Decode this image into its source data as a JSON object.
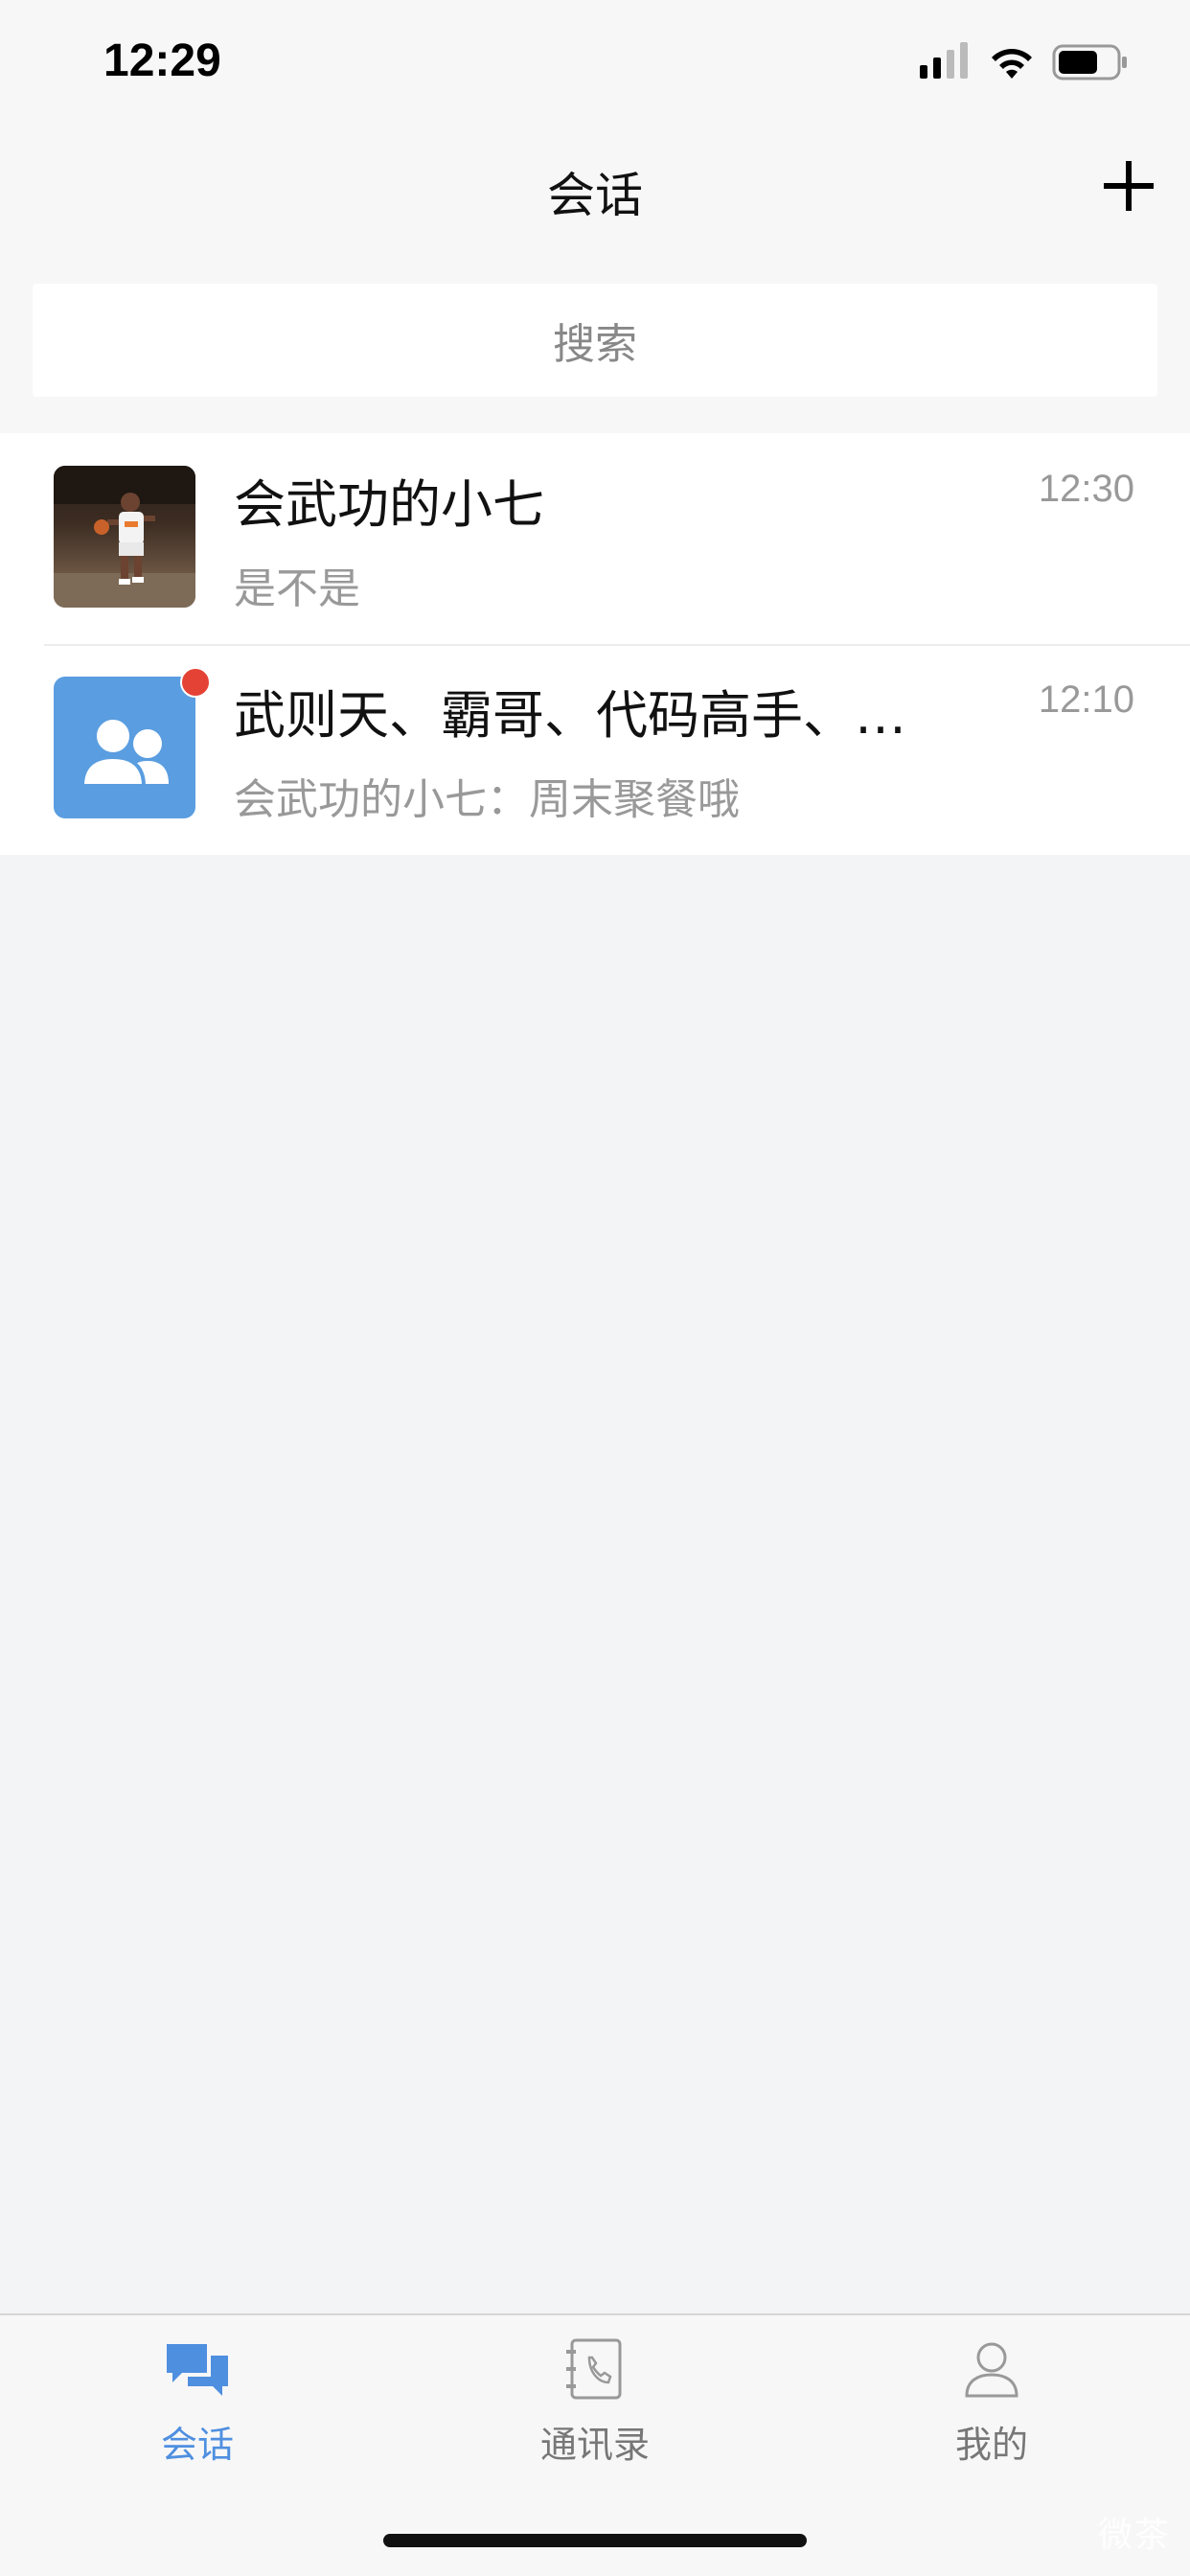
{
  "status_bar": {
    "time": "12:29",
    "signal_icon": "cellular-signal-icon",
    "wifi_icon": "wifi-icon",
    "battery_icon": "battery-icon"
  },
  "nav": {
    "title": "会话",
    "add_icon": "plus-icon"
  },
  "search": {
    "placeholder": "搜索"
  },
  "conversations": [
    {
      "name": "会武功的小七",
      "time": "12:30",
      "preview": "是不是",
      "avatar": "basketball-player-photo",
      "unread": false
    },
    {
      "name": "武则天、霸哥、代码高手、…",
      "time": "12:10",
      "preview": "会武功的小七：周末聚餐哦",
      "avatar": "group-people-icon",
      "unread": true
    }
  ],
  "tabs": [
    {
      "label": "会话",
      "icon": "chat-bubbles-icon",
      "active": true
    },
    {
      "label": "通讯录",
      "icon": "address-book-icon",
      "active": false
    },
    {
      "label": "我的",
      "icon": "person-icon",
      "active": false
    }
  ],
  "colors": {
    "accent": "#4f8fe0",
    "unread_dot": "#e54236",
    "group_avatar": "#5a9de0"
  },
  "watermark": "微茶"
}
